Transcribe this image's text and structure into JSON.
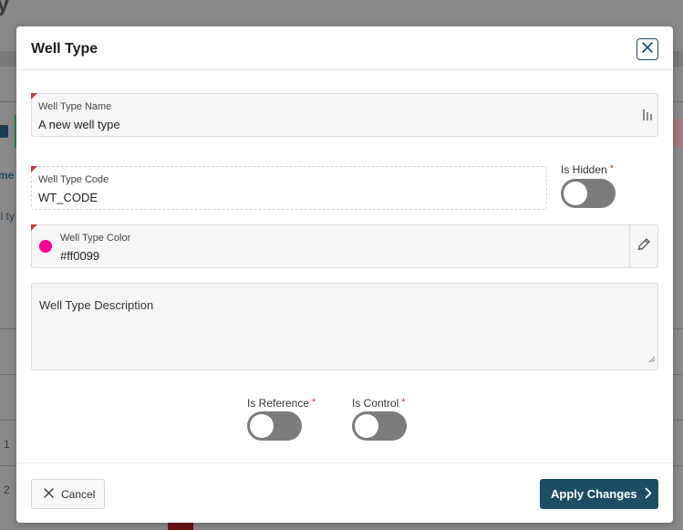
{
  "background": {
    "title_fragment": "y",
    "col_text_1": "me",
    "col_text_2": "ll ty",
    "row_1": "1",
    "row_2": "2"
  },
  "modal": {
    "title": "Well Type",
    "close_icon": "close-icon",
    "well_type_name": {
      "label": "Well Type Name",
      "value": "A new well type"
    },
    "well_type_code": {
      "label": "Well Type Code",
      "value": "WT_CODE"
    },
    "is_hidden": {
      "label": "Is Hidden",
      "required_mark": "*",
      "state": "off"
    },
    "well_type_color": {
      "label": "Well Type Color",
      "value": "#ff0099",
      "swatch_color": "#ff0099",
      "picker_icon": "eyedropper-icon"
    },
    "description": {
      "placeholder": "Well Type Description"
    },
    "is_reference": {
      "label": "Is Reference",
      "required_mark": "*",
      "state": "off"
    },
    "is_control": {
      "label": "Is Control",
      "required_mark": "*",
      "state": "off"
    },
    "footer": {
      "cancel_label": "Cancel",
      "apply_label": "Apply Changes"
    }
  },
  "colors": {
    "accent": "#1b4d63",
    "required": "#d9362b",
    "toggle_off": "#7c7c7c"
  }
}
